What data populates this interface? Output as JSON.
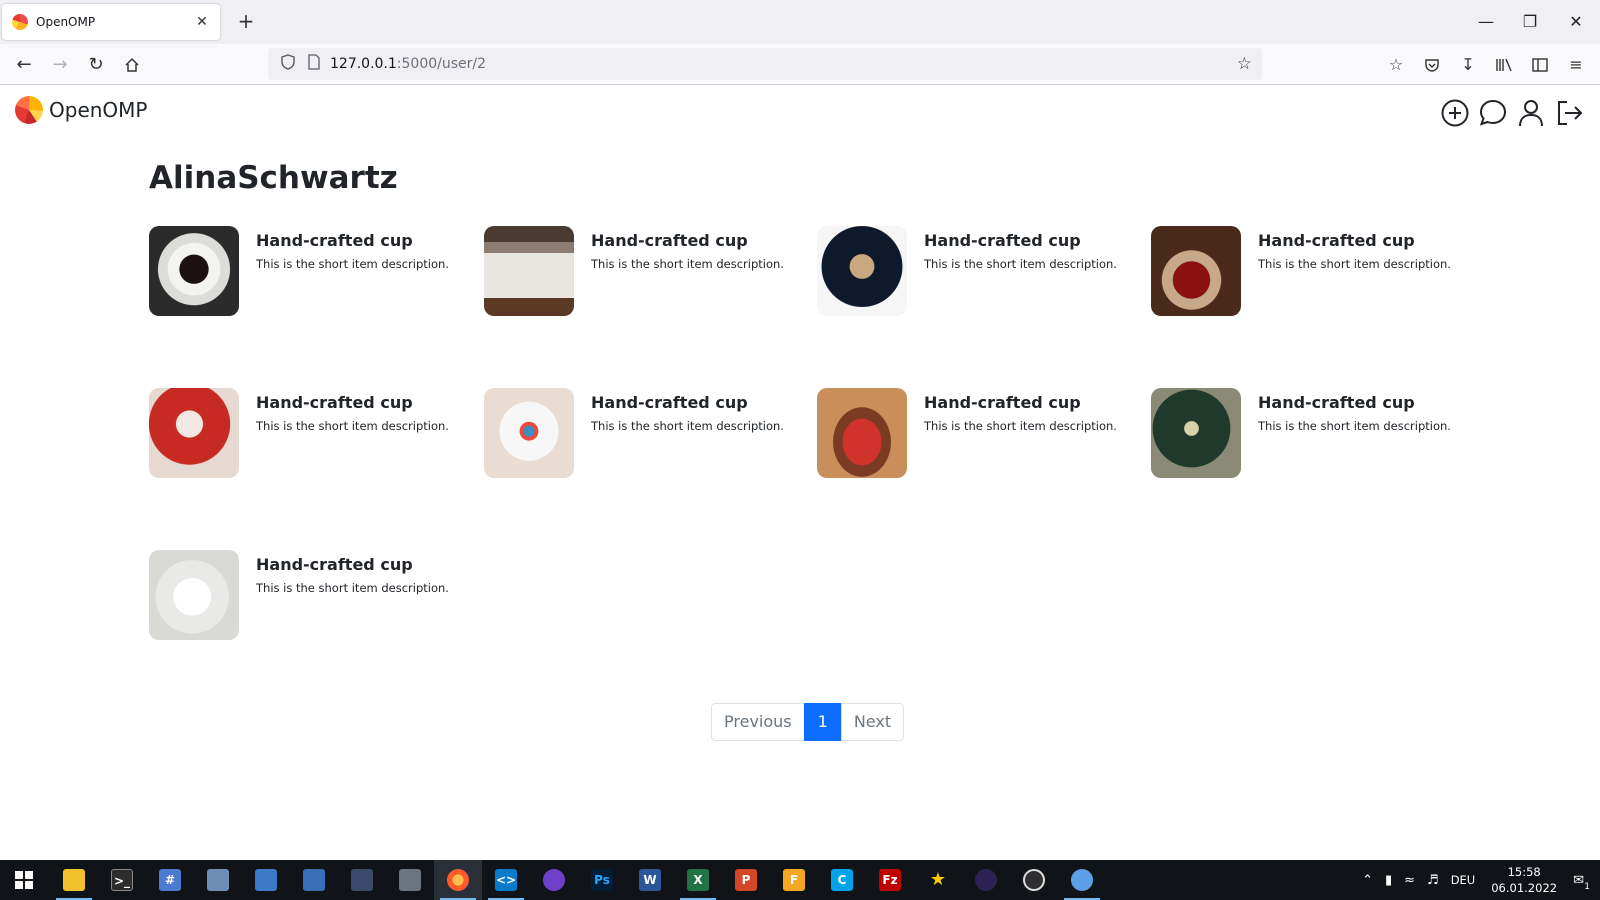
{
  "browser": {
    "tab_title": "OpenOMP",
    "new_tab": "+",
    "tab_close": "✕",
    "url_host": "127.0.0.1",
    "url_path": ":5000/user/2",
    "window_controls": {
      "minimize": "—",
      "restore": "❐",
      "close": "✕"
    }
  },
  "site": {
    "brand": "OpenOMP",
    "header_icons": [
      "add-circle-icon",
      "chat-bubble-icon",
      "user-icon",
      "logout-icon"
    ]
  },
  "profile": {
    "username": "AlinaSchwartz"
  },
  "items": [
    {
      "title": "Hand-crafted cup",
      "description": "This is the short item description."
    },
    {
      "title": "Hand-crafted cup",
      "description": "This is the short item description."
    },
    {
      "title": "Hand-crafted cup",
      "description": "This is the short item description."
    },
    {
      "title": "Hand-crafted cup",
      "description": "This is the short item description."
    },
    {
      "title": "Hand-crafted cup",
      "description": "This is the short item description."
    },
    {
      "title": "Hand-crafted cup",
      "description": "This is the short item description."
    },
    {
      "title": "Hand-crafted cup",
      "description": "This is the short item description."
    },
    {
      "title": "Hand-crafted cup",
      "description": "This is the short item description."
    },
    {
      "title": "Hand-crafted cup",
      "description": "This is the short item description."
    }
  ],
  "pagination": {
    "previous": "Previous",
    "current": "1",
    "next": "Next"
  },
  "taskbar": {
    "language": "DEU",
    "time": "15:58",
    "date": "06.01.2022",
    "notifications": "1"
  },
  "colors": {
    "accent": "#0d6efd",
    "taskbar": "#101418"
  }
}
